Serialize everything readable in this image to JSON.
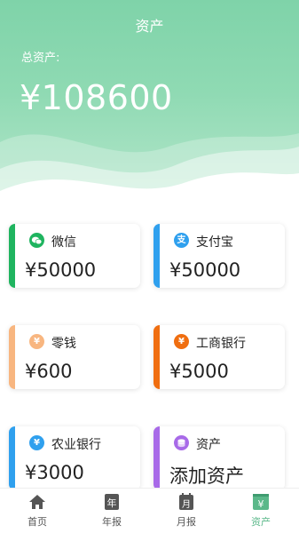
{
  "header": {
    "title": "资产",
    "total_label": "总资产:",
    "total_value": "¥108600"
  },
  "accounts": [
    {
      "name": "微信",
      "amount": "¥50000",
      "icon": "wechat-icon",
      "color": "#1fb45f"
    },
    {
      "name": "支付宝",
      "amount": "¥50000",
      "icon": "alipay-icon",
      "color": "#2fa0ee"
    },
    {
      "name": "零钱",
      "amount": "¥600",
      "icon": "yen-icon",
      "color": "#f8b680"
    },
    {
      "name": "工商银行",
      "amount": "¥5000",
      "icon": "bank-icon",
      "color": "#f06e10"
    },
    {
      "name": "农业银行",
      "amount": "¥3000",
      "icon": "bank-icon",
      "color": "#2fa0ee"
    },
    {
      "name": "资产",
      "amount": "添加资产",
      "icon": "coins-icon",
      "color": "#a86ae8"
    }
  ],
  "tabs": [
    {
      "label": "首页",
      "icon": "home-icon"
    },
    {
      "label": "年报",
      "icon": "calendar-year-icon",
      "glyph": "年"
    },
    {
      "label": "月报",
      "icon": "calendar-month-icon",
      "glyph": "月"
    },
    {
      "label": "资产",
      "icon": "yen-wallet-icon",
      "glyph": "¥",
      "active": true
    }
  ],
  "colors": {
    "accent": "#7fd3a9",
    "active_tab": "#5bb88a"
  }
}
